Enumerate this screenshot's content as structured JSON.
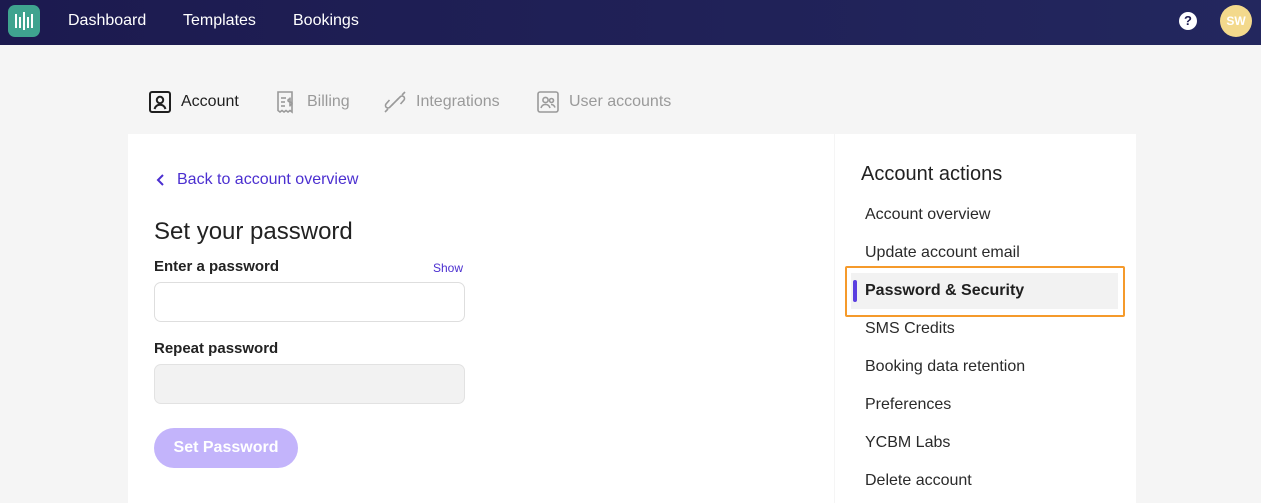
{
  "topbar": {
    "nav": [
      "Dashboard",
      "Templates",
      "Bookings"
    ],
    "help_label": "?",
    "avatar_initials": "SW"
  },
  "tabs": [
    {
      "label": "Account",
      "icon": "account-icon",
      "active": true
    },
    {
      "label": "Billing",
      "icon": "billing-icon",
      "active": false
    },
    {
      "label": "Integrations",
      "icon": "integrations-icon",
      "active": false
    },
    {
      "label": "User accounts",
      "icon": "user-accounts-icon",
      "active": false
    }
  ],
  "form": {
    "back_label": "Back to account overview",
    "title": "Set your password",
    "password_label": "Enter a password",
    "show_label": "Show",
    "password_value": "",
    "repeat_label": "Repeat password",
    "repeat_value": "",
    "submit_label": "Set Password"
  },
  "sidebar": {
    "heading": "Account actions",
    "items": [
      {
        "label": "Account overview"
      },
      {
        "label": "Update account email"
      },
      {
        "label": "Password & Security",
        "active": true
      },
      {
        "label": "SMS Credits"
      },
      {
        "label": "Booking data retention"
      },
      {
        "label": "Preferences"
      },
      {
        "label": "YCBM Labs"
      },
      {
        "label": "Delete account"
      }
    ]
  },
  "colors": {
    "topbar": "#1c1a4f",
    "accent": "#4b2fd0",
    "button_disabled": "#c3b4fb",
    "highlight": "#f59a2b",
    "logo": "#3fa38f",
    "avatar": "#f3d98c"
  }
}
